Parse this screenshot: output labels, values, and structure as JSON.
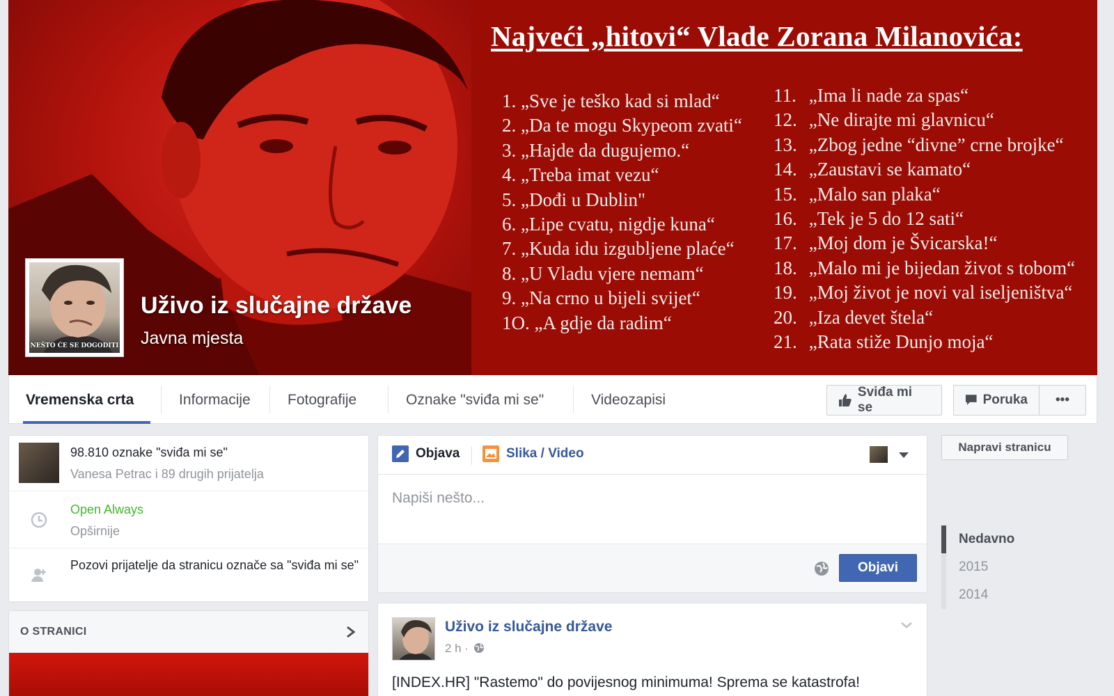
{
  "cover": {
    "title": "Najveći „hitovi“ Vlade Zorana Milanovića:",
    "hits_left": [
      {
        "num": "1.",
        "text": "„Sve je teško kad si mlad“"
      },
      {
        "num": "2.",
        "text": "„Da te mogu Skypeom zvati“"
      },
      {
        "num": "3.",
        "text": "„Hajde da dugujemo.“"
      },
      {
        "num": "4.",
        "text": "„Treba imat vezu“"
      },
      {
        "num": "5.",
        "text": "„Dođi u Dublin\""
      },
      {
        "num": "6.",
        "text": "„Lipe cvatu, nigdje kuna“"
      },
      {
        "num": "7.",
        "text": "„Kuda idu izgubljene plaće“"
      },
      {
        "num": "8.",
        "text": "„U Vladu vjere nemam“"
      },
      {
        "num": "9.",
        "text": "„Na crno u bijeli svijet“"
      },
      {
        "num": "1O.",
        "text": "„A gdje da radim“"
      }
    ],
    "hits_right": [
      {
        "num": "11.",
        "text": "„Ima li nade za spas“"
      },
      {
        "num": "12.",
        "text": "„Ne dirajte mi glavnicu“"
      },
      {
        "num": "13.",
        "text": "„Zbog jedne “divne” crne brojke“"
      },
      {
        "num": "14.",
        "text": "„Zaustavi se kamato“"
      },
      {
        "num": "15.",
        "text": "„Malo san plaka“"
      },
      {
        "num": "16.",
        "text": "„Tek je 5 do 12 sati“"
      },
      {
        "num": "17.",
        "text": "„Moj dom je Švicarska!“"
      },
      {
        "num": "18.",
        "text": "„Malo mi je bijedan život s tobom“"
      },
      {
        "num": "19.",
        "text": "„Moj život je novi val iseljeništva“"
      },
      {
        "num": "20.",
        "text": "„Iza devet štela“"
      },
      {
        "num": "21.",
        "text": "„Rata stiže Dunjo moja“"
      }
    ],
    "profile_caption": "NEŠTO ĆE SE DOGODITI"
  },
  "page": {
    "name": "Uživo iz slučajne države",
    "category": "Javna mjesta"
  },
  "nav": {
    "tabs": [
      "Vremenska crta",
      "Informacije",
      "Fotografije",
      "Oznake \"sviđa mi se\"",
      "Videozapisi"
    ],
    "like_button": "Sviđa mi se",
    "message_button": "Poruka",
    "more_button": "•••"
  },
  "left": {
    "likes_count": "98.810 oznake \"sviđa mi se\"",
    "likes_friends": "Vanesa Petrac i 89 drugih prijatelja",
    "hours_status": "Open Always",
    "hours_more": "Opširnije",
    "invite_text": "Pozovi prijatelje da stranicu označe sa \"sviđa mi se\"",
    "about_header": "O STRANICI"
  },
  "composer": {
    "tab_post": "Objava",
    "tab_photo": "Slika / Video",
    "placeholder": "Napiši nešto...",
    "post_button": "Objavi"
  },
  "post": {
    "author": "Uživo iz slučajne države",
    "time": "2 h ·",
    "text": "[INDEX.HR] \"Rastemo\" do povijesnog minimuma! Sprema se katastrofa!"
  },
  "right": {
    "create_page": "Napravi stranicu",
    "timeline": [
      "Nedavno",
      "2015",
      "2014"
    ]
  },
  "colors": {
    "brand_blue": "#4267b2",
    "cover_red": "#9a0c04",
    "link_blue": "#365899",
    "green": "#42b72a"
  }
}
